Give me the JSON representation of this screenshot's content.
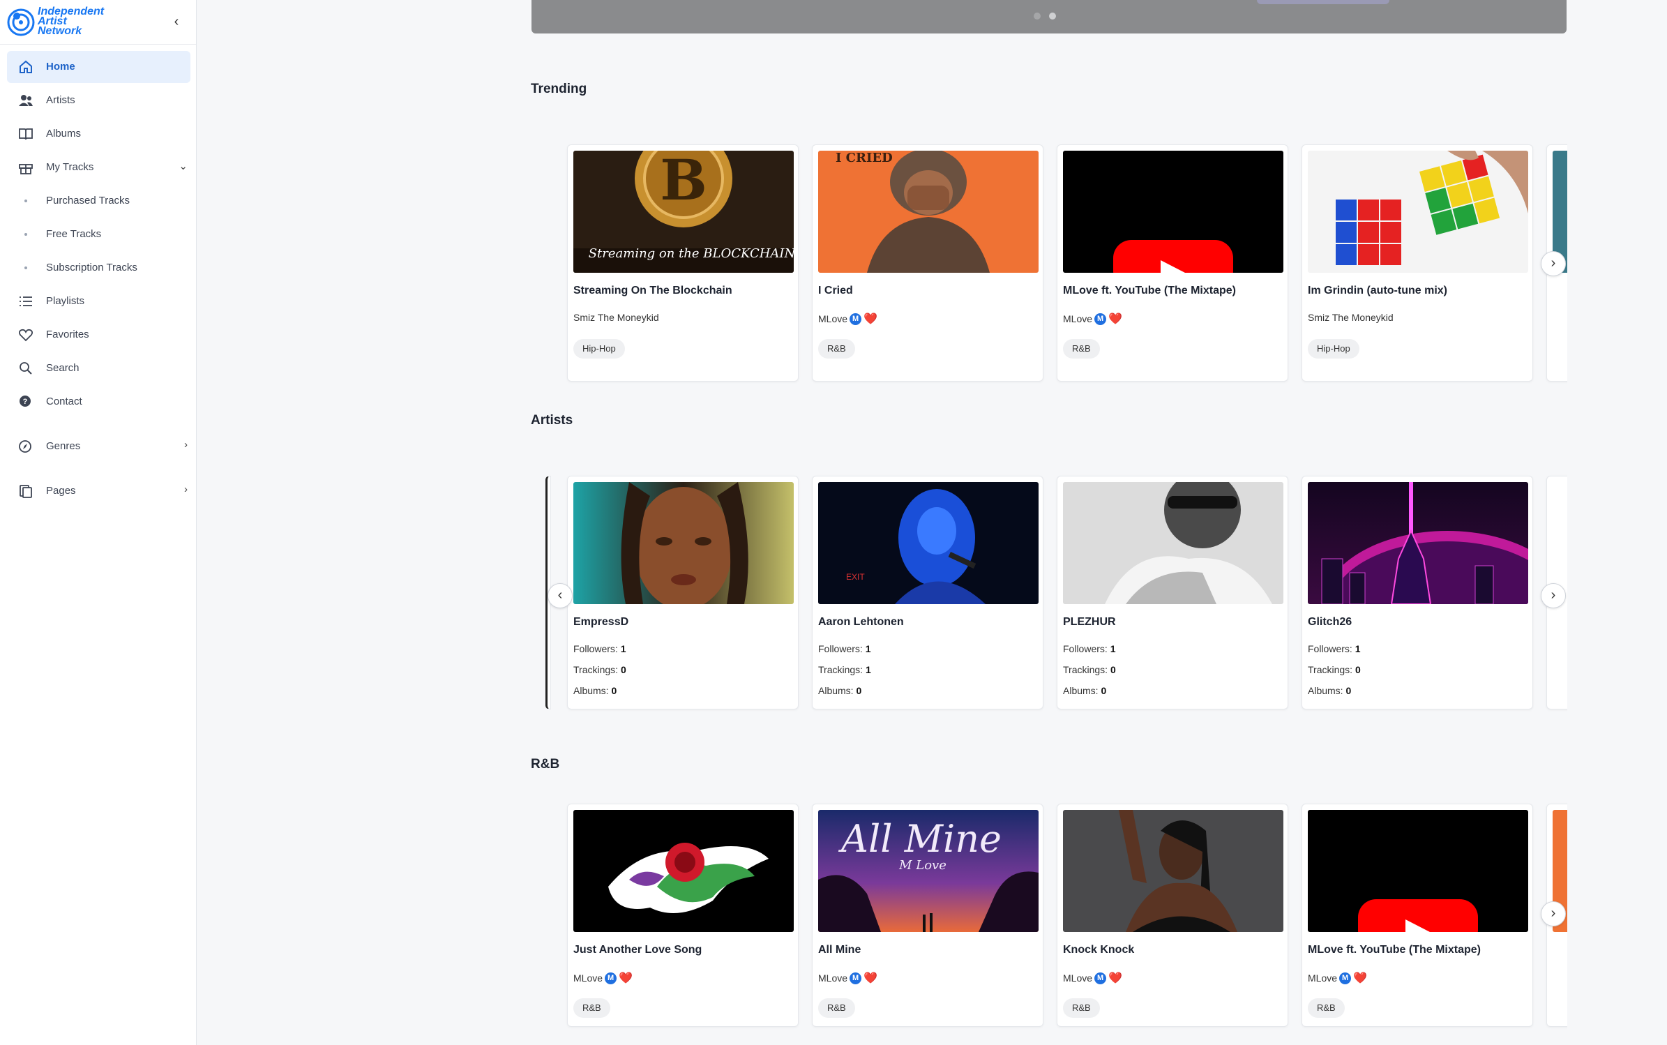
{
  "app": {
    "logo_text": [
      "Independent",
      "Artist",
      "Network"
    ],
    "accent": "#1877f2"
  },
  "sidebar": {
    "items": [
      {
        "label": "Home",
        "icon": "home-icon",
        "active": true
      },
      {
        "label": "Artists",
        "icon": "users-icon"
      },
      {
        "label": "Albums",
        "icon": "book-icon"
      },
      {
        "label": "My Tracks",
        "icon": "gift-icon",
        "arrow": "expanded"
      },
      {
        "label": "Purchased Tracks",
        "sub": true
      },
      {
        "label": "Free Tracks",
        "sub": true
      },
      {
        "label": "Subscription Tracks",
        "sub": true
      },
      {
        "label": "Playlists",
        "icon": "list-icon"
      },
      {
        "label": "Favorites",
        "icon": "heart-icon"
      },
      {
        "label": "Search",
        "icon": "search-icon"
      },
      {
        "label": "Contact",
        "icon": "help-icon"
      },
      {
        "label": "Genres",
        "icon": "compass-icon",
        "arrow": "collapsed"
      },
      {
        "label": "Pages",
        "icon": "pages-icon",
        "arrow": "collapsed"
      }
    ]
  },
  "sections": {
    "trending": {
      "title": "Trending",
      "cards": [
        {
          "title": "Streaming On The Blockchain",
          "artist": "Smiz The Moneykid",
          "genre": "Hip-Hop"
        },
        {
          "title": "I Cried",
          "artist": "MLove",
          "verified": true,
          "genre": "R&B"
        },
        {
          "title": "MLove ft. YouTube (The Mixtape)",
          "artist": "MLove",
          "verified": true,
          "genre": "R&B"
        },
        {
          "title": "Im Grindin (auto-tune mix)",
          "artist": "Smiz The Moneykid",
          "genre": "Hip-Hop"
        }
      ],
      "art_text": {
        "blockchain": "Streaming on the BLOCKCHAIN",
        "cried": "I CRIED"
      }
    },
    "artists": {
      "title": "Artists",
      "labels": {
        "followers": "Followers:",
        "trackings": "Trackings:",
        "albums": "Albums:"
      },
      "cards": [
        {
          "name": "EmpressD",
          "followers": "1",
          "trackings": "0",
          "albums": "0"
        },
        {
          "name": "Aaron Lehtonen",
          "followers": "1",
          "trackings": "1",
          "albums": "0"
        },
        {
          "name": "PLEZHUR",
          "followers": "1",
          "trackings": "0",
          "albums": "0"
        },
        {
          "name": "Glitch26",
          "followers": "1",
          "trackings": "0",
          "albums": "0"
        }
      ]
    },
    "rnb": {
      "title": "R&B",
      "cards": [
        {
          "title": "Just Another Love Song",
          "artist": "MLove",
          "verified": true,
          "genre": "R&B"
        },
        {
          "title": "All Mine",
          "artist": "MLove",
          "verified": true,
          "genre": "R&B"
        },
        {
          "title": "Knock Knock",
          "artist": "MLove",
          "verified": true,
          "genre": "R&B"
        },
        {
          "title": "MLove ft. YouTube (The Mixtape)",
          "artist": "MLove",
          "verified": true,
          "genre": "R&B"
        }
      ],
      "art_text": {
        "allmine": "All Mine",
        "allmine_sub": "M Love"
      }
    }
  },
  "verified_badge": "M",
  "heart_glyph": "❤️"
}
